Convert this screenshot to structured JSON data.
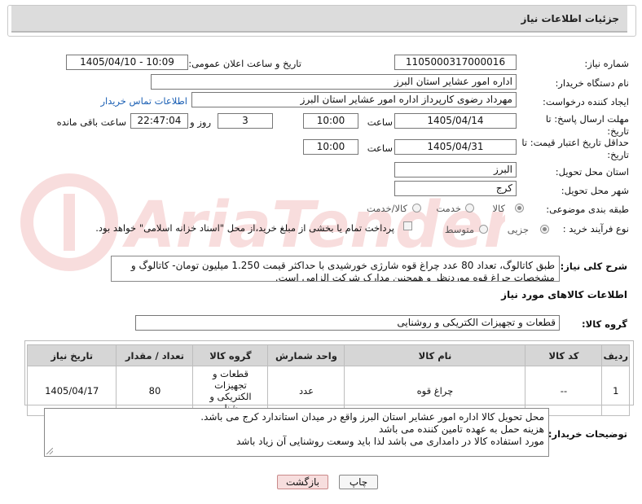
{
  "header": {
    "title": "جزئیات اطلاعات نیاز"
  },
  "fields": {
    "need_number_label": "شماره نیاز:",
    "need_number": "1105000317000016",
    "announce_label": "تاریخ و ساعت اعلان عمومی:",
    "announce_value": "1405/04/10 - 10:09",
    "buyer_org_label": "نام دستگاه خریدار:",
    "buyer_org": "اداره امور عشایر استان البرز",
    "requester_label": "ایجاد کننده درخواست:",
    "requester": "مهرداد رضوی کارپرداز اداره امور عشایر استان البرز",
    "contact_link": "اطلاعات تماس خریدار",
    "deadline_label": "مهلت ارسال پاسخ: تا تاریخ:",
    "deadline_date": "1405/04/14",
    "time_label": "ساعت",
    "deadline_time": "10:00",
    "days_value": "3",
    "days_label": "روز و",
    "remaining_time": "22:47:04",
    "remaining_label": "ساعت باقی مانده",
    "validity_label": "حداقل تاریخ اعتبار قیمت: تا تاریخ:",
    "validity_date": "1405/04/31",
    "validity_time_label": "ساعت",
    "validity_time": "10:00",
    "province_label": "استان محل تحویل:",
    "province": "البرز",
    "city_label": "شهر محل تحویل:",
    "city": "کرج",
    "category_label": "طبقه بندی موضوعی:",
    "category_options": [
      "کالا",
      "خدمت",
      "کالا/خدمت"
    ],
    "process_label": "نوع فرآیند خرید :",
    "process_options": [
      "جزیی",
      "متوسط"
    ],
    "payment_note": "پرداخت تمام یا بخشی از مبلغ خرید،از محل \"اسناد خزانه اسلامی\" خواهد بود."
  },
  "description": {
    "label": "شرح کلی نیاز:",
    "text": "طبق کاتالوگ، تعداد 80 عدد چراغ قوه شارژی خورشیدی با حداکثر قیمت 1.250 میلیون تومان- کاتالوگ و مشخصات چراغ قوه موردنظر و همچنین مدارک شرکت الزامی است."
  },
  "goods_info": {
    "title": "اطلاعات کالاهای مورد نیاز",
    "group_label": "گروه کالا:",
    "group_value": "قطعات و تجهیزات الکتریکی و روشنایی"
  },
  "table": {
    "headers": [
      "ردیف",
      "کد کالا",
      "نام کالا",
      "واحد شمارش",
      "گروه کالا",
      "تعداد / مقدار",
      "تاریخ نیاز"
    ],
    "rows": [
      {
        "row": "1",
        "code": "--",
        "name": "چراغ قوه",
        "unit": "عدد",
        "group": "قطعات و تجهیزات الکتریکی و روشنایی",
        "qty": "80",
        "date": "1405/04/17"
      }
    ]
  },
  "buyer_notes": {
    "label": "توضیحات خریدار:",
    "lines": [
      "محل تحویل کالا اداره امور عشایر استان البرز واقع در میدان استاندارد کرج می باشد.",
      "هزینه حمل به عهده تامین کننده می باشد",
      "مورد استفاده کالا در دامداری می باشد لذا باید وسعت روشنایی آن زیاد باشد"
    ]
  },
  "buttons": {
    "print": "چاپ",
    "back": "بازگشت"
  },
  "colors": {
    "back_button_bg": "#f7dede",
    "back_button_border": "#c98a8a"
  }
}
